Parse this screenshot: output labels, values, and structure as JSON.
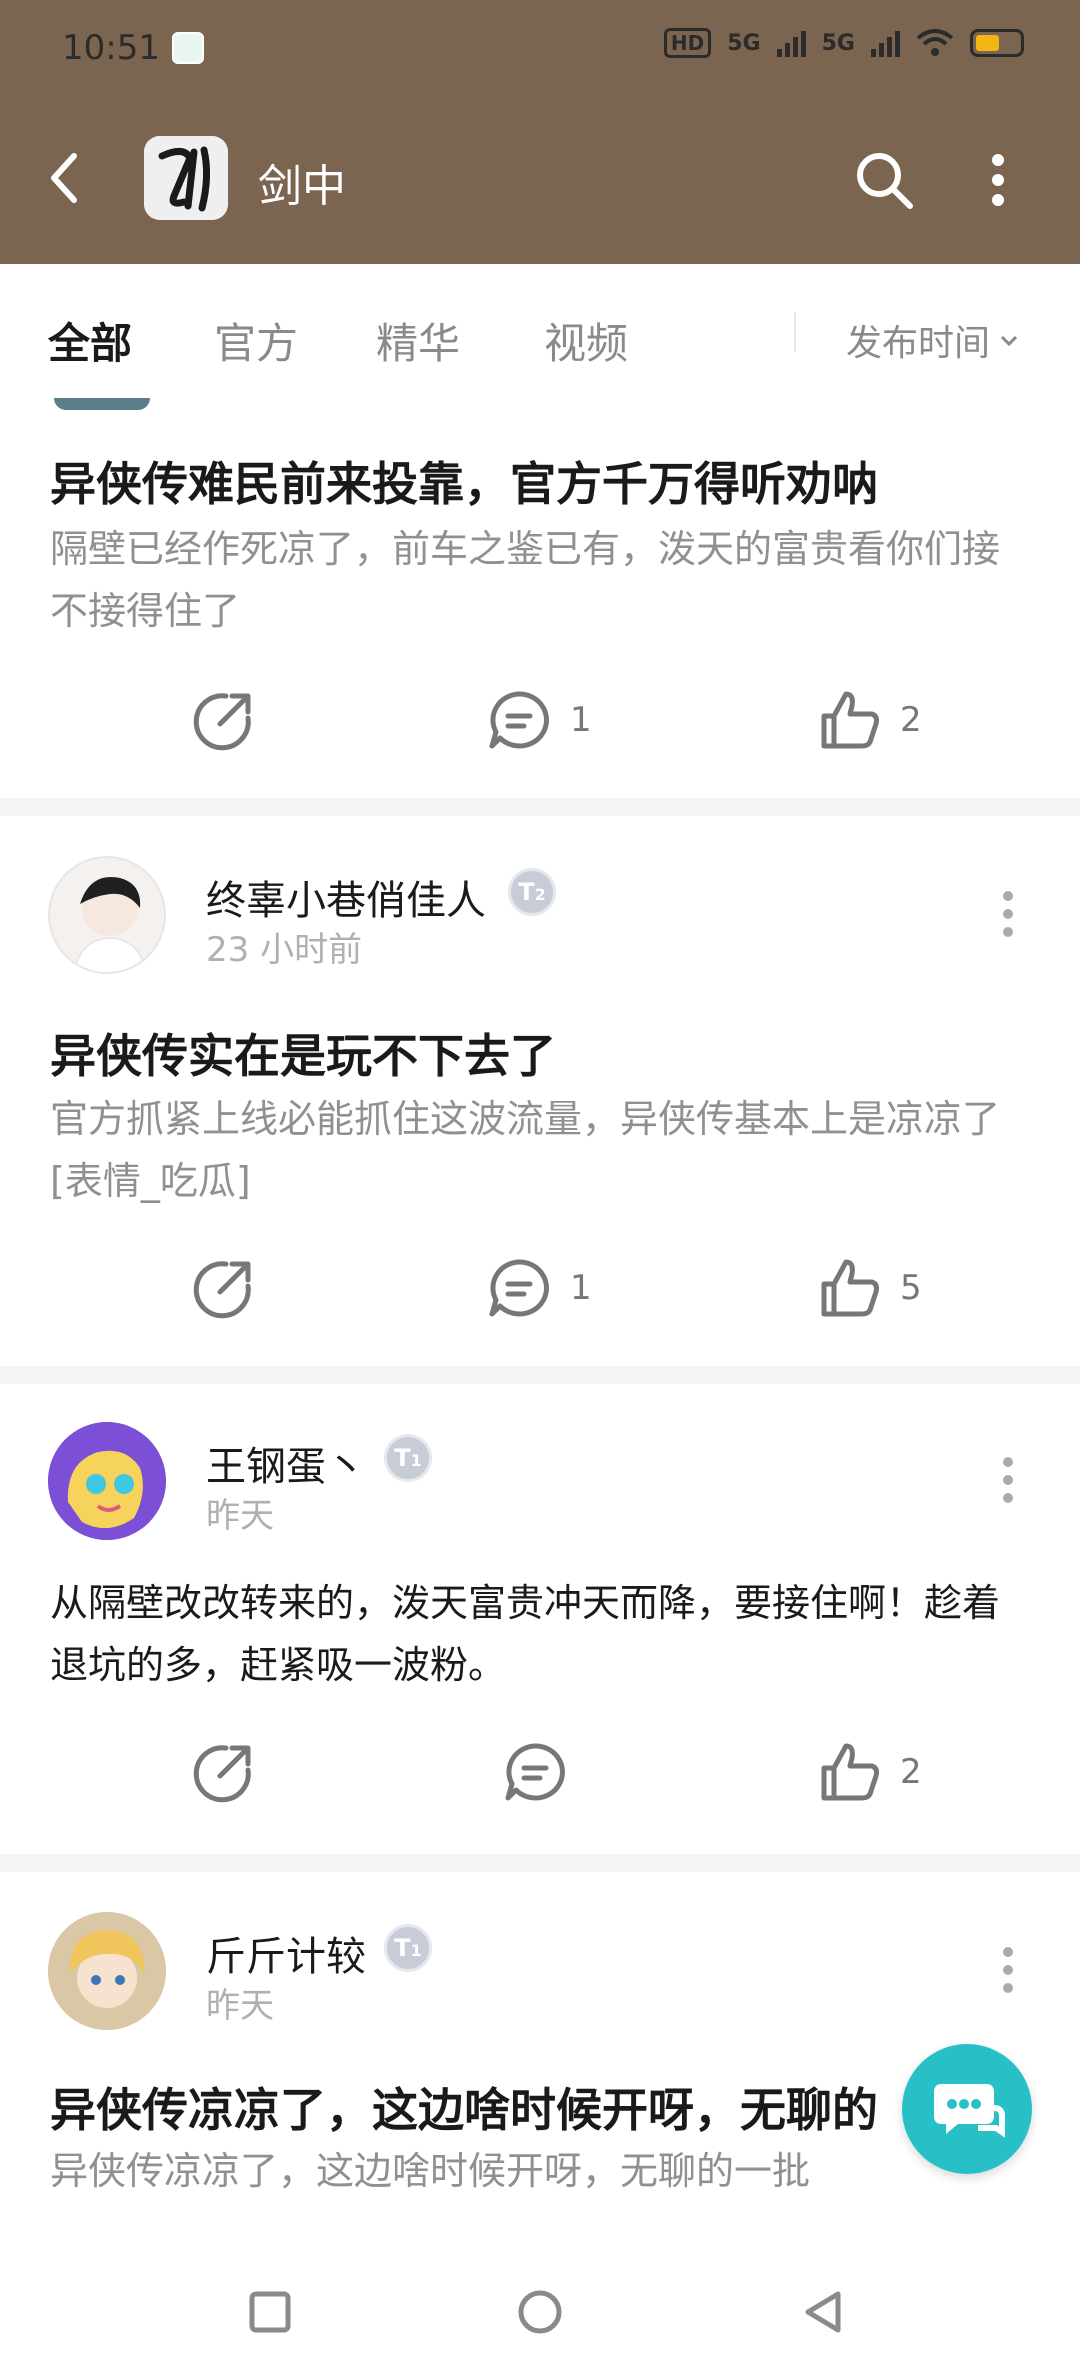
{
  "status": {
    "time": "10:51",
    "hd": "HD",
    "net1": "5G",
    "net2": "5G"
  },
  "header": {
    "title": "剑中"
  },
  "tabs": [
    {
      "label": "全部",
      "active": true
    },
    {
      "label": "官方",
      "active": false
    },
    {
      "label": "精华",
      "active": false
    },
    {
      "label": "视频",
      "active": false
    }
  ],
  "sort_label": "发布时间",
  "posts": [
    {
      "title": "异侠传难民前来投靠，官方千万得听劝呐",
      "body": "隔壁已经作死凉了，前车之鉴已有，泼天的富贵看你们接不接得住了",
      "comments": "1",
      "likes": "2"
    },
    {
      "user": "终辜小巷俏佳人",
      "level": "2",
      "time": "23 小时前",
      "title": "异侠传实在是玩不下去了",
      "body": "官方抓紧上线必能抓住这波流量，异侠传基本上是凉凉了[表情_吃瓜]",
      "comments": "1",
      "likes": "5"
    },
    {
      "user": "王钢蛋丶",
      "level": "1",
      "time": "昨天",
      "body": "从隔壁改改转来的，泼天富贵冲天而降，要接住啊！趁着退坑的多，赶紧吸一波粉。",
      "likes": "2"
    },
    {
      "user": "斤斤计较",
      "level": "1",
      "time": "昨天",
      "title": "异侠传凉凉了，这边啥时候开呀，无聊的",
      "body": "异侠传凉凉了，这边啥时候开呀，无聊的一批"
    }
  ],
  "colors": {
    "header_bg": "#7b6450",
    "accent": "#27c0c6"
  }
}
